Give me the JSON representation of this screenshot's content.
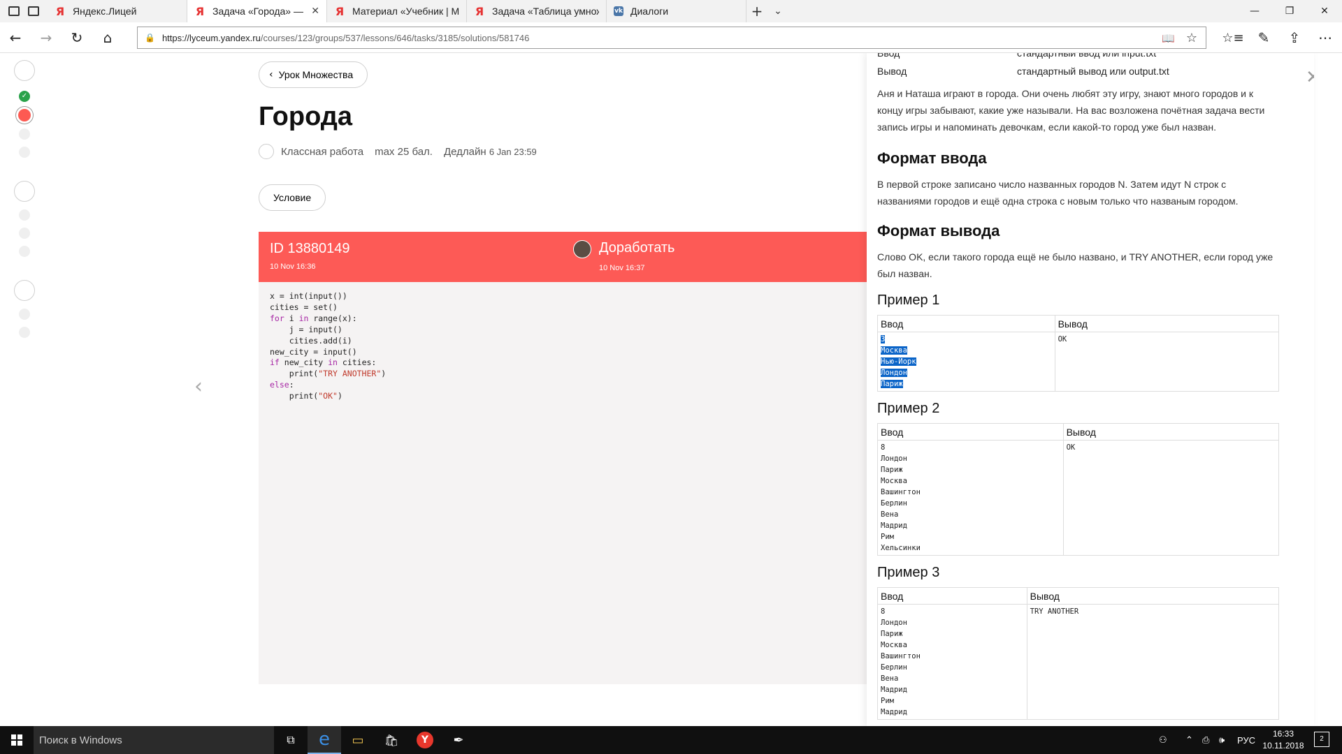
{
  "tabs": [
    {
      "label": "Яндекс.Лицей",
      "icon": "yandex-icon",
      "active": false,
      "close": ""
    },
    {
      "label": "Задача «Города» — Мі",
      "icon": "yandex-icon",
      "active": true,
      "close": "✕"
    },
    {
      "label": "Материал «Учебник | Мно",
      "icon": "yandex-icon",
      "active": false,
      "close": ""
    },
    {
      "label": "Задача «Таблица умножен",
      "icon": "yandex-icon",
      "active": false,
      "close": ""
    },
    {
      "label": "Диалоги",
      "icon": "vk-icon",
      "active": false,
      "close": ""
    }
  ],
  "tab_icon_letter": "Я",
  "vk_letter": "vk",
  "new_tab": "+",
  "tab_list": "⌄",
  "window": {
    "minimize": "—",
    "maximize": "❐",
    "close": "✕"
  },
  "nav": {
    "back": "←",
    "forward": "→",
    "refresh": "↻",
    "home": "⌂",
    "lock": "🔒",
    "reading_view": "📖",
    "favorite": "☆",
    "favorites_hub": "☆≡",
    "notes": "✎",
    "share": "⇪",
    "more": "⋯"
  },
  "address": {
    "url_host": "https://lyceum.yandex.ru",
    "url_path": "/courses/123/groups/537/lessons/646/tasks/3185/solutions/581746"
  },
  "lesson": {
    "back_label": "Урок Множества",
    "back_chevron": "‹",
    "title": "Города",
    "kind": "Классная работа",
    "max_score": "max 25 бал.",
    "deadline_label": "Дедлайн",
    "deadline_value": "6 Jan 23:59",
    "condition_button": "Условие"
  },
  "solution": {
    "id": "ID 13880149",
    "submitted": "10 Nov 16:36",
    "status": "Доработать",
    "reviewed": "10 Nov 16:37",
    "color": "#fd5a56",
    "code_lines": [
      "x = int(input())",
      "cities = set()",
      "for i in range(x):",
      "    j = input()",
      "    cities.add(i)",
      "new_city = input()",
      "if new_city in cities:",
      "    print(\"TRY ANOTHER\")",
      "else:",
      "    print(\"OK\")"
    ]
  },
  "pager": {
    "prev": "‹"
  },
  "statement": {
    "close": "✕",
    "input_label": "Ввод",
    "input_value": "стандартный ввод или input.txt",
    "output_label": "Вывод",
    "output_value": "стандартный вывод или output.txt",
    "intro": "Аня и Наташа играют в города. Они очень любят эту игру, знают много городов и к концу игры забывают, какие уже называли. На вас возложена почётная задача вести запись игры и напоминать девочкам, если какой-то город уже был назван.",
    "input_format_title": "Формат ввода",
    "input_format_text": "В первой строке записано число названных городов N. Затем идут N строк с названиями городов и ещё одна строка с новым только что названым городом.",
    "output_format_title": "Формат вывода",
    "output_format_text": "Слово OK, если такого города ещё не было названо, и TRY ANOTHER, если город уже был назван.",
    "examples": [
      {
        "title": "Пример 1",
        "in_label": "Ввод",
        "out_label": "Вывод",
        "input": [
          "3",
          "Москва",
          "Нью-Йорк",
          "Лондон",
          "Париж"
        ],
        "output": [
          "OK"
        ],
        "selected": true
      },
      {
        "title": "Пример 2",
        "in_label": "Ввод",
        "out_label": "Вывод",
        "input": [
          "8",
          "Лондон",
          "Париж",
          "Москва",
          "Вашингтон",
          "Берлин",
          "Вена",
          "Мадрид",
          "Рим",
          "Хельсинки"
        ],
        "output": [
          "OK"
        ],
        "selected": false
      },
      {
        "title": "Пример 3",
        "in_label": "Ввод",
        "out_label": "Вывод",
        "input": [
          "8",
          "Лондон",
          "Париж",
          "Москва",
          "Вашингтон",
          "Берлин",
          "Вена",
          "Мадрид",
          "Рим",
          "Мадрид"
        ],
        "output": [
          "TRY ANOTHER"
        ],
        "selected": false
      }
    ],
    "scroll_up": "▲",
    "scroll_down": "▼"
  },
  "stepper": {
    "ok_mark": "✓"
  },
  "taskbar": {
    "search_placeholder": "Поиск в Windows",
    "task_view": "⧉",
    "edge": "e",
    "explorer": "▭",
    "store": "🛍",
    "yandex": "Y",
    "pen": "✒",
    "people": "⚇",
    "up": "⌃",
    "network": "⎙",
    "volume": "🕪",
    "lang": "РУС",
    "time": "16:33",
    "date": "10.11.2018",
    "notifications": "2"
  }
}
